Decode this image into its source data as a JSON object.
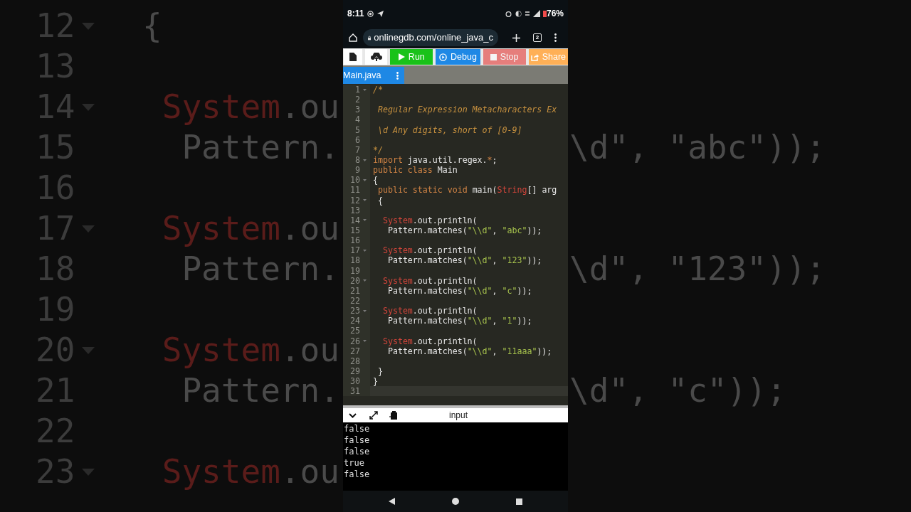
{
  "backdrop": {
    "lines": [
      {
        "number": "12",
        "fold": true,
        "tokens": [
          {
            "text": "{",
            "kind": "text"
          }
        ]
      },
      {
        "number": "13",
        "fold": false
      },
      {
        "number": "14",
        "fold": true,
        "tokens": [
          {
            "text": " System",
            "kind": "type"
          },
          {
            "text": ".ou",
            "kind": "text"
          }
        ]
      },
      {
        "number": "15",
        "fold": false,
        "tokens": [
          {
            "text": "  Pattern.",
            "kind": "text"
          }
        ],
        "tail": "\\d\", \"abc\"));"
      },
      {
        "number": "16",
        "fold": false
      },
      {
        "number": "17",
        "fold": true,
        "tokens": [
          {
            "text": " System",
            "kind": "type"
          },
          {
            "text": ".ou",
            "kind": "text"
          }
        ]
      },
      {
        "number": "18",
        "fold": false,
        "tokens": [
          {
            "text": "  Pattern.",
            "kind": "text"
          }
        ],
        "tail": "\\d\", \"123\"));"
      },
      {
        "number": "19",
        "fold": false
      },
      {
        "number": "20",
        "fold": true,
        "tokens": [
          {
            "text": " System",
            "kind": "type"
          },
          {
            "text": ".ou",
            "kind": "text"
          }
        ]
      },
      {
        "number": "21",
        "fold": false,
        "tokens": [
          {
            "text": "  Pattern.",
            "kind": "text"
          }
        ],
        "tail": "\\d\", \"c\"));"
      },
      {
        "number": "22",
        "fold": false
      },
      {
        "number": "23",
        "fold": true,
        "tokens": [
          {
            "text": " System",
            "kind": "type"
          },
          {
            "text": ".ou",
            "kind": "text"
          }
        ]
      }
    ]
  },
  "status_bar": {
    "time": "8:11",
    "battery": "76%"
  },
  "browser": {
    "url": "onlinegdb.com/online_java_c",
    "tab_count": "2"
  },
  "toolbar": [
    {
      "kind": "file",
      "disabled": false
    },
    {
      "kind": "upload",
      "disabled": false
    },
    {
      "kind": "run",
      "label": "Run",
      "disabled": false
    },
    {
      "kind": "debug",
      "label": "Debug",
      "disabled": false
    },
    {
      "kind": "stop",
      "label": "Stop",
      "disabled": true
    },
    {
      "kind": "share",
      "label": "Share",
      "disabled": false
    }
  ],
  "tabs": [
    {
      "label": "Main.java",
      "selected": true
    }
  ],
  "editor": {
    "lines": [
      {
        "number": "1",
        "fold": true,
        "active": false,
        "tokens": [
          {
            "text": "/*",
            "kind": "comment"
          }
        ]
      },
      {
        "number": "2",
        "fold": false,
        "active": false
      },
      {
        "number": "3",
        "fold": false,
        "active": false,
        "tokens": [
          {
            "text": " Regular Expression Metacharacters Ex",
            "kind": "comment"
          }
        ]
      },
      {
        "number": "4",
        "fold": false,
        "active": false
      },
      {
        "number": "5",
        "fold": false,
        "active": false,
        "tokens": [
          {
            "text": " \\d Any digits, short of [0-9]",
            "kind": "comment"
          }
        ]
      },
      {
        "number": "6",
        "fold": false,
        "active": false
      },
      {
        "number": "7",
        "fold": false,
        "active": false,
        "tokens": [
          {
            "text": "*/",
            "kind": "comment"
          }
        ]
      },
      {
        "number": "8",
        "fold": true,
        "active": false,
        "tokens": [
          {
            "text": "import",
            "kind": "keyword"
          },
          {
            "text": " java.util.regex.",
            "kind": "text"
          },
          {
            "text": "*",
            "kind": "keyword"
          },
          {
            "text": ";",
            "kind": "text"
          }
        ]
      },
      {
        "number": "9",
        "fold": false,
        "active": false,
        "tokens": [
          {
            "text": "public",
            "kind": "keyword"
          },
          {
            "text": " class",
            "kind": "keyword"
          },
          {
            "text": " Main",
            "kind": "text"
          }
        ]
      },
      {
        "number": "10",
        "fold": true,
        "active": false,
        "tokens": [
          {
            "text": "{",
            "kind": "text"
          }
        ]
      },
      {
        "number": "11",
        "fold": false,
        "active": false,
        "tokens": [
          {
            "text": " public",
            "kind": "keyword"
          },
          {
            "text": " static",
            "kind": "keyword"
          },
          {
            "text": " void",
            "kind": "keyword"
          },
          {
            "text": " main(",
            "kind": "text"
          },
          {
            "text": "String",
            "kind": "type"
          },
          {
            "text": "[] arg",
            "kind": "text"
          }
        ]
      },
      {
        "number": "12",
        "fold": true,
        "active": false,
        "tokens": [
          {
            "text": " {",
            "kind": "text"
          }
        ]
      },
      {
        "number": "13",
        "fold": false,
        "active": false
      },
      {
        "number": "14",
        "fold": true,
        "active": false,
        "tokens": [
          {
            "text": "  System",
            "kind": "type"
          },
          {
            "text": ".out.println(",
            "kind": "text"
          }
        ]
      },
      {
        "number": "15",
        "fold": false,
        "active": false,
        "tokens": [
          {
            "text": "   Pattern.matches(",
            "kind": "text"
          },
          {
            "text": "\"\\\\d\"",
            "kind": "string"
          },
          {
            "text": ", ",
            "kind": "text"
          },
          {
            "text": "\"abc\"",
            "kind": "string"
          },
          {
            "text": "));",
            "kind": "text"
          }
        ]
      },
      {
        "number": "16",
        "fold": false,
        "active": false
      },
      {
        "number": "17",
        "fold": true,
        "active": false,
        "tokens": [
          {
            "text": "  System",
            "kind": "type"
          },
          {
            "text": ".out.println(",
            "kind": "text"
          }
        ]
      },
      {
        "number": "18",
        "fold": false,
        "active": false,
        "tokens": [
          {
            "text": "   Pattern.matches(",
            "kind": "text"
          },
          {
            "text": "\"\\\\d\"",
            "kind": "string"
          },
          {
            "text": ", ",
            "kind": "text"
          },
          {
            "text": "\"123\"",
            "kind": "string"
          },
          {
            "text": "));",
            "kind": "text"
          }
        ]
      },
      {
        "number": "19",
        "fold": false,
        "active": false
      },
      {
        "number": "20",
        "fold": true,
        "active": false,
        "tokens": [
          {
            "text": "  System",
            "kind": "type"
          },
          {
            "text": ".out.println(",
            "kind": "text"
          }
        ]
      },
      {
        "number": "21",
        "fold": false,
        "active": false,
        "tokens": [
          {
            "text": "   Pattern.matches(",
            "kind": "text"
          },
          {
            "text": "\"\\\\d\"",
            "kind": "string"
          },
          {
            "text": ", ",
            "kind": "text"
          },
          {
            "text": "\"c\"",
            "kind": "string"
          },
          {
            "text": "));",
            "kind": "text"
          }
        ]
      },
      {
        "number": "22",
        "fold": false,
        "active": false
      },
      {
        "number": "23",
        "fold": true,
        "active": false,
        "tokens": [
          {
            "text": "  System",
            "kind": "type"
          },
          {
            "text": ".out.println(",
            "kind": "text"
          }
        ]
      },
      {
        "number": "24",
        "fold": false,
        "active": false,
        "tokens": [
          {
            "text": "   Pattern.matches(",
            "kind": "text"
          },
          {
            "text": "\"\\\\d\"",
            "kind": "string"
          },
          {
            "text": ", ",
            "kind": "text"
          },
          {
            "text": "\"1\"",
            "kind": "string"
          },
          {
            "text": "));",
            "kind": "text"
          }
        ]
      },
      {
        "number": "25",
        "fold": false,
        "active": false
      },
      {
        "number": "26",
        "fold": true,
        "active": false,
        "tokens": [
          {
            "text": "  System",
            "kind": "type"
          },
          {
            "text": ".out.println(",
            "kind": "text"
          }
        ]
      },
      {
        "number": "27",
        "fold": false,
        "active": false,
        "tokens": [
          {
            "text": "   Pattern.matches(",
            "kind": "text"
          },
          {
            "text": "\"\\\\d\"",
            "kind": "string"
          },
          {
            "text": ", ",
            "kind": "text"
          },
          {
            "text": "\"11aaa\"",
            "kind": "string"
          },
          {
            "text": "));",
            "kind": "text"
          }
        ]
      },
      {
        "number": "28",
        "fold": false,
        "active": false
      },
      {
        "number": "29",
        "fold": false,
        "active": false,
        "tokens": [
          {
            "text": " }",
            "kind": "text"
          }
        ]
      },
      {
        "number": "30",
        "fold": false,
        "active": false,
        "tokens": [
          {
            "text": "}",
            "kind": "text"
          }
        ]
      },
      {
        "number": "31",
        "fold": false,
        "active": true
      }
    ]
  },
  "output": {
    "header": "input",
    "lines": [
      "false",
      "false",
      "false",
      "true",
      "false"
    ]
  }
}
